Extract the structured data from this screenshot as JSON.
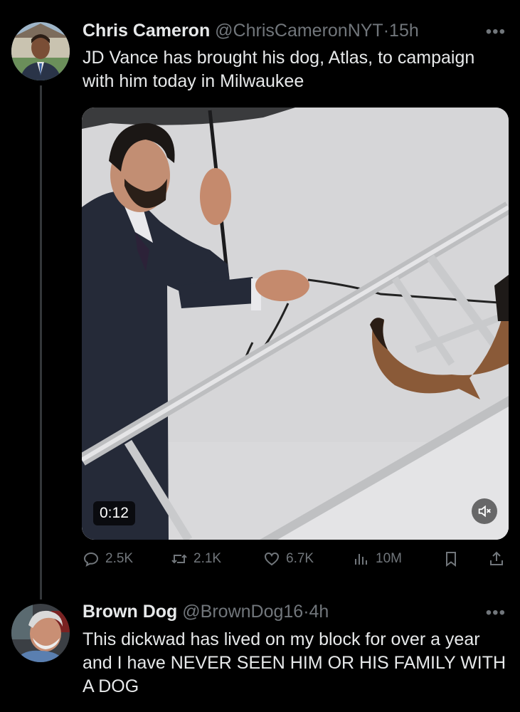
{
  "tweets": [
    {
      "author_name": "Chris Cameron",
      "handle": "@ChrisCameronNYT",
      "separator": "·",
      "time": "15h",
      "more": "•••",
      "text": "JD Vance has brought his dog, Atlas, to campaign with him today in Milwaukee",
      "video": {
        "duration": "0:12"
      },
      "stats": {
        "replies": "2.5K",
        "reposts": "2.1K",
        "likes": "6.7K",
        "views": "10M"
      }
    },
    {
      "author_name": "Brown Dog",
      "handle": "@BrownDog16",
      "separator": "·",
      "time": "4h",
      "more": "•••",
      "text": "This dickwad has lived on my block for over a year and I have NEVER SEEN HIM OR HIS FAMILY WITH A DOG"
    }
  ],
  "icons": {
    "reply": "reply-icon",
    "repost": "repost-icon",
    "like": "heart-icon",
    "views": "views-icon",
    "bookmark": "bookmark-icon",
    "share": "share-icon",
    "mute": "mute-icon",
    "more": "more-icon"
  },
  "colors": {
    "background": "#000000",
    "text": "#e7e9ea",
    "muted": "#71767b",
    "thread_line": "#333639"
  }
}
